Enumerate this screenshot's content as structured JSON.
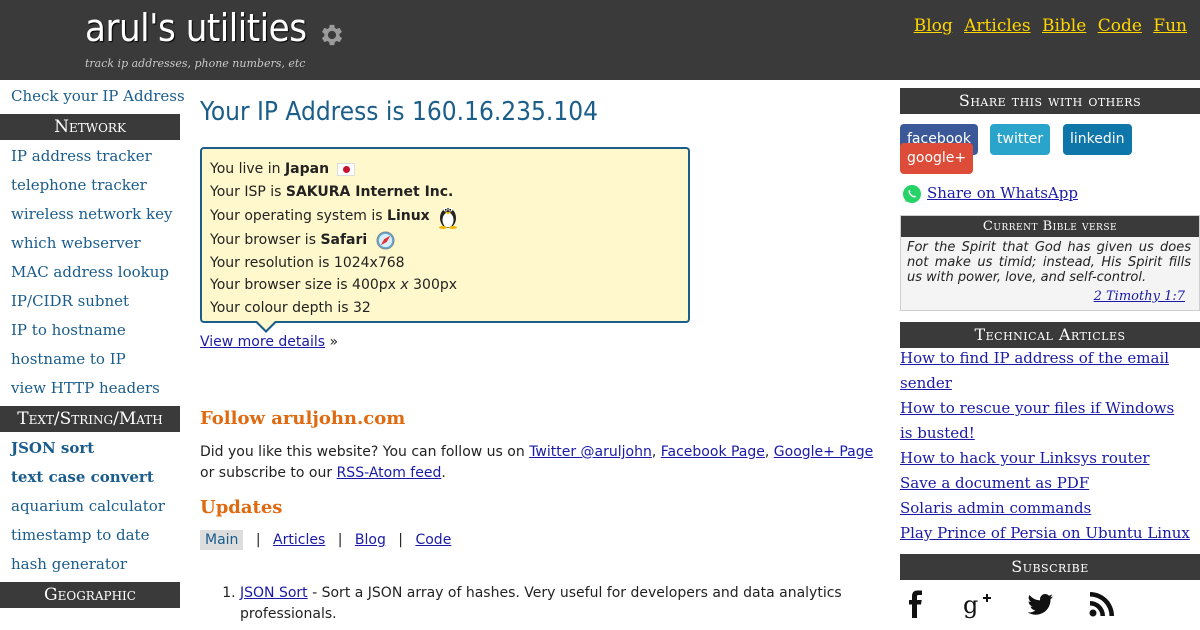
{
  "header": {
    "title": "arul's utilities",
    "tagline": "track ip addresses, phone numbers, etc",
    "nav": [
      "Blog",
      "Articles",
      "Bible",
      "Code",
      "Fun"
    ]
  },
  "left_sidebar": {
    "top_link": "Check your IP Address",
    "sections": [
      {
        "heading": "Network",
        "items": [
          "IP address tracker",
          "telephone tracker",
          "wireless network key",
          "which webserver",
          "MAC address lookup",
          "IP/CIDR subnet",
          "IP to hostname",
          "hostname to IP",
          "view HTTP headers"
        ]
      },
      {
        "heading": "Text/String/Math",
        "items": [
          "JSON sort",
          "text case convert",
          "aquarium calculator",
          "timestamp to date",
          "hash generator"
        ]
      },
      {
        "heading": "Geographic",
        "items": []
      }
    ]
  },
  "main": {
    "ip_heading": "Your IP Address is 160.16.235.104",
    "info": {
      "country_prefix": "You live in",
      "country": "Japan",
      "isp_prefix": "Your ISP is",
      "isp": "SAKURA Internet Inc.",
      "os_prefix": "Your operating system is",
      "os": "Linux",
      "browser_prefix": "Your browser is",
      "browser": "Safari",
      "resolution": "Your resolution is 1024x768",
      "browser_size_prefix": "Your browser size is 400px",
      "browser_size_x": "x",
      "browser_size_suffix": "300px",
      "colour_depth": "Your colour depth is 32"
    },
    "more_details_link": "View more details",
    "more_details_suffix": "»",
    "follow": {
      "heading": "Follow aruljohn.com",
      "text_1": "Did you like this website? You can follow us on",
      "twitter": "Twitter @aruljohn",
      "facebook": "Facebook Page",
      "googleplus": "Google+ Page",
      "text_2": "or subscribe to our",
      "rss": "RSS-Atom feed",
      "text_3": "."
    },
    "updates": {
      "heading": "Updates",
      "tabs": [
        "Main",
        "Articles",
        "Blog",
        "Code"
      ],
      "items": [
        {
          "link": "JSON Sort",
          "text": " - Sort a JSON array of hashes. Very useful for developers and data analytics professionals."
        }
      ]
    }
  },
  "right_sidebar": {
    "share_heading": "Share this with others",
    "share_buttons": [
      {
        "label": "facebook",
        "color": "#3b5998"
      },
      {
        "label": "twitter",
        "color": "#2ba4cc"
      },
      {
        "label": "linkedin",
        "color": "#0e76a8"
      },
      {
        "label": "google+",
        "color": "#dd4b39"
      }
    ],
    "whatsapp": "Share on WhatsApp",
    "bible_heading": "Current Bible verse",
    "verse": "For the Spirit that God has given us does not make us timid; instead, His Spirit fills us with power, love, and self-control.",
    "verse_ref": "2 Timothy 1:7",
    "tech_heading": "Technical Articles",
    "tech_articles": [
      "How to find IP address of the email sender",
      "How to rescue your files if Windows is busted!",
      "How to hack your Linksys router",
      "Save a document as PDF",
      "Solaris admin commands",
      "Play Prince of Persia on Ubuntu Linux"
    ],
    "subscribe_heading": "Subscribe",
    "subscribe_icons": [
      "facebook-icon",
      "google-plus-icon",
      "twitter-icon",
      "rss-icon"
    ]
  },
  "colors": {
    "header_bg": "#3a3a3a",
    "nav_link": "#ffd600",
    "heading_blue": "#1c5e8a",
    "heading_orange": "#e06a10",
    "info_box_bg": "#fff8cc"
  }
}
